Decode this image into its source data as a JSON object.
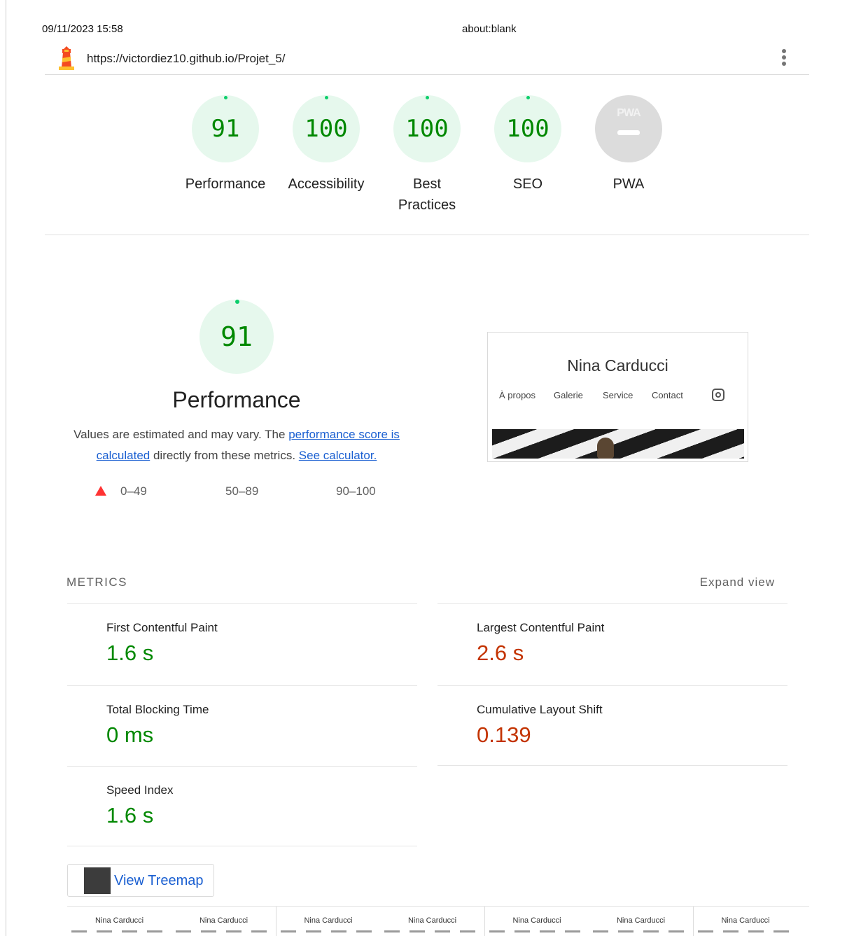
{
  "print_header": {
    "date": "09/11/2023 15:58",
    "title": "about:blank"
  },
  "topbar": {
    "url": "https://victordiez10.github.io/Projet_5/",
    "logo_icon": "lighthouse-icon",
    "menu_icon": "kebab-menu-icon"
  },
  "gauges": [
    {
      "score": "91",
      "label": "Performance"
    },
    {
      "score": "100",
      "label": "Accessibility"
    },
    {
      "score": "100",
      "label": "Best Practices"
    },
    {
      "score": "100",
      "label": "SEO"
    },
    {
      "score": "PWA",
      "label": "PWA"
    }
  ],
  "colors": {
    "pass": "#008800",
    "pass_bg": "#e6f8ed",
    "average": "#c33300",
    "fail": "#ff3333",
    "link": "#1a5fd1"
  },
  "performance": {
    "score": "91",
    "title": "Performance",
    "desc_prefix": "Values are estimated and may vary. The ",
    "desc_link1": "performance score is calculated",
    "desc_middle": " directly from these metrics. ",
    "desc_link2": "See calculator.",
    "legend": {
      "fail": "0–49",
      "average": "50–89",
      "pass": "90–100"
    }
  },
  "screenshot": {
    "title": "Nina Carducci",
    "nav": [
      "À propos",
      "Galerie",
      "Service",
      "Contact"
    ],
    "social_icon": "instagram-icon"
  },
  "metrics": {
    "title": "METRICS",
    "expand_label": "Expand view",
    "items": [
      {
        "label": "First Contentful Paint",
        "value": "1.6 s",
        "rating": "pass"
      },
      {
        "label": "Largest Contentful Paint",
        "value": "2.6 s",
        "rating": "average"
      },
      {
        "label": "Total Blocking Time",
        "value": "0 ms",
        "rating": "pass"
      },
      {
        "label": "Cumulative Layout Shift",
        "value": "0.139",
        "rating": "average"
      },
      {
        "label": "Speed Index",
        "value": "1.6 s",
        "rating": "pass"
      }
    ]
  },
  "treemap": {
    "label": "View Treemap",
    "icon": "treemap-icon"
  },
  "filmstrip": {
    "frame_title": "Nina Carducci"
  }
}
